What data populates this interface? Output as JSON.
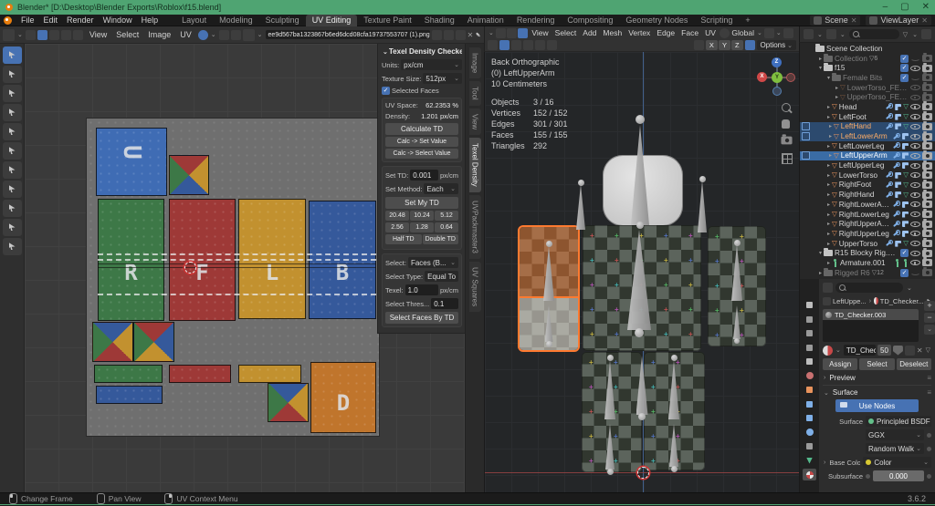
{
  "titlebar": {
    "title": "Blender* [D:\\Desktop\\Blender Exports\\Roblox\\f15.blend]",
    "window_controls": [
      "–",
      "▢",
      "✕"
    ]
  },
  "menubar": {
    "menus": [
      "File",
      "Edit",
      "Render",
      "Window",
      "Help"
    ],
    "workspaces": [
      "Layout",
      "Modeling",
      "Sculpting",
      "UV Editing",
      "Texture Paint",
      "Shading",
      "Animation",
      "Rendering",
      "Compositing",
      "Geometry Nodes",
      "Scripting"
    ],
    "active_workspace": "UV Editing",
    "add_workspace": "+",
    "scene": "Scene",
    "view_layer": "ViewLayer"
  },
  "uv_editor": {
    "menus": [
      "View",
      "Select",
      "Image",
      "UV"
    ],
    "image_name": "ee9d567ba1323867b6ed6dcd08cfa19737553707 (1).png",
    "tools": [
      "tweak-select",
      "cursor",
      "move",
      "rotate",
      "scale",
      "transform",
      "annotate",
      "rip-region",
      "relax",
      "grab",
      "pin"
    ],
    "sidebar_tabs": [
      "Image",
      "Tool",
      "View",
      "Texel Density",
      "UVPackmaster3",
      "UV Squares"
    ],
    "active_sidebar_tab": "Texel Density",
    "image": {
      "letters": {
        "up": "U",
        "right": "R",
        "front": "F",
        "left": "L",
        "back": "B",
        "down": "D"
      },
      "palette": {
        "green": "#3d7847",
        "red": "#9e3937",
        "yellow": "#c2912f",
        "blue": "#35599b",
        "blue_bright": "#3f6cb4",
        "orange": "#c0752c"
      }
    }
  },
  "texel_panel": {
    "title": "Texel Density Checker",
    "units_label": "Units:",
    "units_value": "px/cm",
    "texture_size_label": "Texture Size:",
    "texture_size_value": "512px",
    "selected_faces_label": "Selected Faces",
    "uv_space_label": "UV Space:",
    "uv_space_value": "62.2353 %",
    "density_label": "Density:",
    "density_value": "1.201 px/cm",
    "calculate_btn": "Calculate TD",
    "calc_set_btn": "Calc -> Set Value",
    "calc_select_btn": "Calc -> Select Value",
    "set_td_label": "Set TD:",
    "set_td_value": "0.001",
    "set_td_unit": "px/cm",
    "set_method_label": "Set Method:",
    "set_method_value": "Each",
    "set_my_td_btn": "Set My TD",
    "presets": [
      "20.48",
      "10.24",
      "5.12",
      "2.56",
      "1.28",
      "0.64"
    ],
    "half_btn": "Half TD",
    "double_btn": "Double TD",
    "select_label": "Select:",
    "select_value": "Faces (B...",
    "select_type_label": "Select Type:",
    "select_type_value": "Equal To",
    "texel_label": "Texel:",
    "texel_value": "1.0",
    "texel_unit": "px/cm",
    "thres_label": "Select Thres...",
    "thres_value": "0.1",
    "select_faces_btn": "Select Faces By TD"
  },
  "viewport": {
    "menus": [
      "View",
      "Select",
      "Add",
      "Mesh",
      "Vertex",
      "Edge",
      "Face",
      "UV"
    ],
    "orientation": "Global",
    "mirror_axes": [
      "X",
      "Y",
      "Z"
    ],
    "options_label": "Options",
    "overlay": {
      "view": "Back Orthographic",
      "object": "(0) LeftUpperArm",
      "scale": "10 Centimeters"
    },
    "stats": [
      {
        "label": "Objects",
        "value": "3 / 16"
      },
      {
        "label": "Vertices",
        "value": "152 / 152"
      },
      {
        "label": "Edges",
        "value": "301 / 301"
      },
      {
        "label": "Faces",
        "value": "155 / 155"
      },
      {
        "label": "Triangles",
        "value": "292"
      }
    ],
    "gizmo_axes": {
      "x": "X",
      "y": "Y",
      "z": "Z"
    },
    "colors": {
      "axis_x": "#b04848",
      "axis_z_line": "#4a6fa5",
      "selection_orange": "#ff7a30",
      "checker_dark": "#31372f",
      "checker_light": "#5c645c",
      "head": "#d9d9d9"
    }
  },
  "outliner": {
    "rows": [
      {
        "label": "Scene Collection",
        "depth": 0,
        "type": "collection",
        "arrow": "",
        "state": "normal"
      },
      {
        "label": "Collection",
        "depth": 1,
        "type": "collection",
        "arrow": "▸",
        "state": "grey",
        "badge": "6",
        "check": true,
        "eye": "closed",
        "cam": true
      },
      {
        "label": "f15",
        "depth": 1,
        "type": "collection",
        "arrow": "▾",
        "state": "normal",
        "check": true,
        "eye": "open",
        "cam": true
      },
      {
        "label": "Female Bits",
        "depth": 2,
        "type": "collection",
        "arrow": "▾",
        "state": "grey",
        "check": true,
        "eye": "closed",
        "cam": true
      },
      {
        "label": "LowerTorso_FEMALE",
        "depth": 3,
        "type": "mesh",
        "arrow": "▸",
        "state": "grey",
        "eye": "open",
        "cam": true
      },
      {
        "label": "UpperTorso_FEMALE",
        "depth": 3,
        "type": "mesh",
        "arrow": "▸",
        "state": "grey",
        "eye": "open",
        "cam": true
      },
      {
        "label": "Head",
        "depth": 2,
        "type": "mesh",
        "arrow": "▸",
        "state": "normal",
        "mods": true,
        "data": true,
        "eye": "open",
        "cam": true
      },
      {
        "label": "LeftFoot",
        "depth": 2,
        "type": "mesh",
        "arrow": "▸",
        "state": "normal",
        "mods": true,
        "data": true,
        "eye": "open",
        "cam": true
      },
      {
        "label": "LeftHand",
        "depth": 2,
        "type": "mesh",
        "arrow": "▸",
        "state": "selected",
        "orange": true,
        "marker": true,
        "mods": true,
        "data": true,
        "eye": "open",
        "cam": true
      },
      {
        "label": "LeftLowerArm",
        "depth": 2,
        "type": "mesh",
        "arrow": "▸",
        "state": "selected",
        "orange": true,
        "marker": true,
        "mods": true,
        "eye": "open",
        "cam": true
      },
      {
        "label": "LeftLowerLeg",
        "depth": 2,
        "type": "mesh",
        "arrow": "▸",
        "state": "normal",
        "mods": true,
        "eye": "open",
        "cam": true
      },
      {
        "label": "LeftUpperArm",
        "depth": 2,
        "type": "mesh",
        "arrow": "▸",
        "state": "active",
        "marker": true,
        "mods": true,
        "eye": "open",
        "cam": true
      },
      {
        "label": "LeftUpperLeg",
        "depth": 2,
        "type": "mesh",
        "arrow": "▸",
        "state": "normal",
        "mods": true,
        "eye": "open",
        "cam": true
      },
      {
        "label": "LowerTorso",
        "depth": 2,
        "type": "mesh",
        "arrow": "▸",
        "state": "normal",
        "mods": true,
        "data": true,
        "eye": "open",
        "cam": true
      },
      {
        "label": "RightFoot",
        "depth": 2,
        "type": "mesh",
        "arrow": "▸",
        "state": "normal",
        "mods": true,
        "data": true,
        "eye": "open",
        "cam": true
      },
      {
        "label": "RightHand",
        "depth": 2,
        "type": "mesh",
        "arrow": "▸",
        "state": "normal",
        "mods": true,
        "data": true,
        "eye": "open",
        "cam": true
      },
      {
        "label": "RightLowerArm",
        "depth": 2,
        "type": "mesh",
        "arrow": "▸",
        "state": "normal",
        "mods": true,
        "eye": "open",
        "cam": true
      },
      {
        "label": "RightLowerLeg",
        "depth": 2,
        "type": "mesh",
        "arrow": "▸",
        "state": "normal",
        "mods": true,
        "eye": "open",
        "cam": true
      },
      {
        "label": "RightUpperArm",
        "depth": 2,
        "type": "mesh",
        "arrow": "▸",
        "state": "normal",
        "mods": true,
        "eye": "open",
        "cam": true
      },
      {
        "label": "RightUpperLeg",
        "depth": 2,
        "type": "mesh",
        "arrow": "▸",
        "state": "normal",
        "mods": true,
        "eye": "open",
        "cam": true
      },
      {
        "label": "UpperTorso",
        "depth": 2,
        "type": "mesh",
        "arrow": "▸",
        "state": "normal",
        "mods": true,
        "data": true,
        "eye": "open",
        "cam": true
      },
      {
        "label": "R15 Blocky Rig.001",
        "depth": 1,
        "type": "collection",
        "arrow": "▾",
        "state": "normal",
        "check": true,
        "eye": "open",
        "cam": true
      },
      {
        "label": "Armature.001",
        "depth": 2,
        "type": "armature",
        "arrow": "▸",
        "state": "normal",
        "persons": true,
        "eye": "open",
        "cam": true
      },
      {
        "label": "Rigged R6",
        "depth": 1,
        "type": "collection",
        "arrow": "▸",
        "state": "grey",
        "badge": "12",
        "check": true,
        "eye": "closed",
        "cam": true
      }
    ]
  },
  "properties": {
    "tabs": [
      "tool",
      "render",
      "output",
      "view-layer",
      "scene",
      "world",
      "object",
      "modifiers",
      "particles",
      "physics",
      "constraints",
      "data",
      "material"
    ],
    "active_tab": "material",
    "breadcrumb": {
      "object": "LeftUppe...",
      "material": "TD_Checker..."
    },
    "slot_name": "TD_Checker.003",
    "material_name": "TD_Check...",
    "material_users": "50",
    "assign": "Assign",
    "select": "Select",
    "deselect": "Deselect",
    "preview_label": "Preview",
    "surface_section": "Surface",
    "use_nodes": "Use Nodes",
    "surface_label": "Surface",
    "surface_value": "Principled BSDF",
    "distribution_value": "GGX",
    "sss_method_value": "Random Walk",
    "base_color_label": "Base Color",
    "base_color_value": "Color",
    "subsurface_label": "Subsurface",
    "subsurface_value": "0.000"
  },
  "statusbar": {
    "items": [
      {
        "label": "Change Frame",
        "button": "left"
      },
      {
        "label": "Pan View",
        "button": "middle"
      },
      {
        "label": "UV Context Menu",
        "button": "right"
      }
    ],
    "version": "3.6.2"
  }
}
